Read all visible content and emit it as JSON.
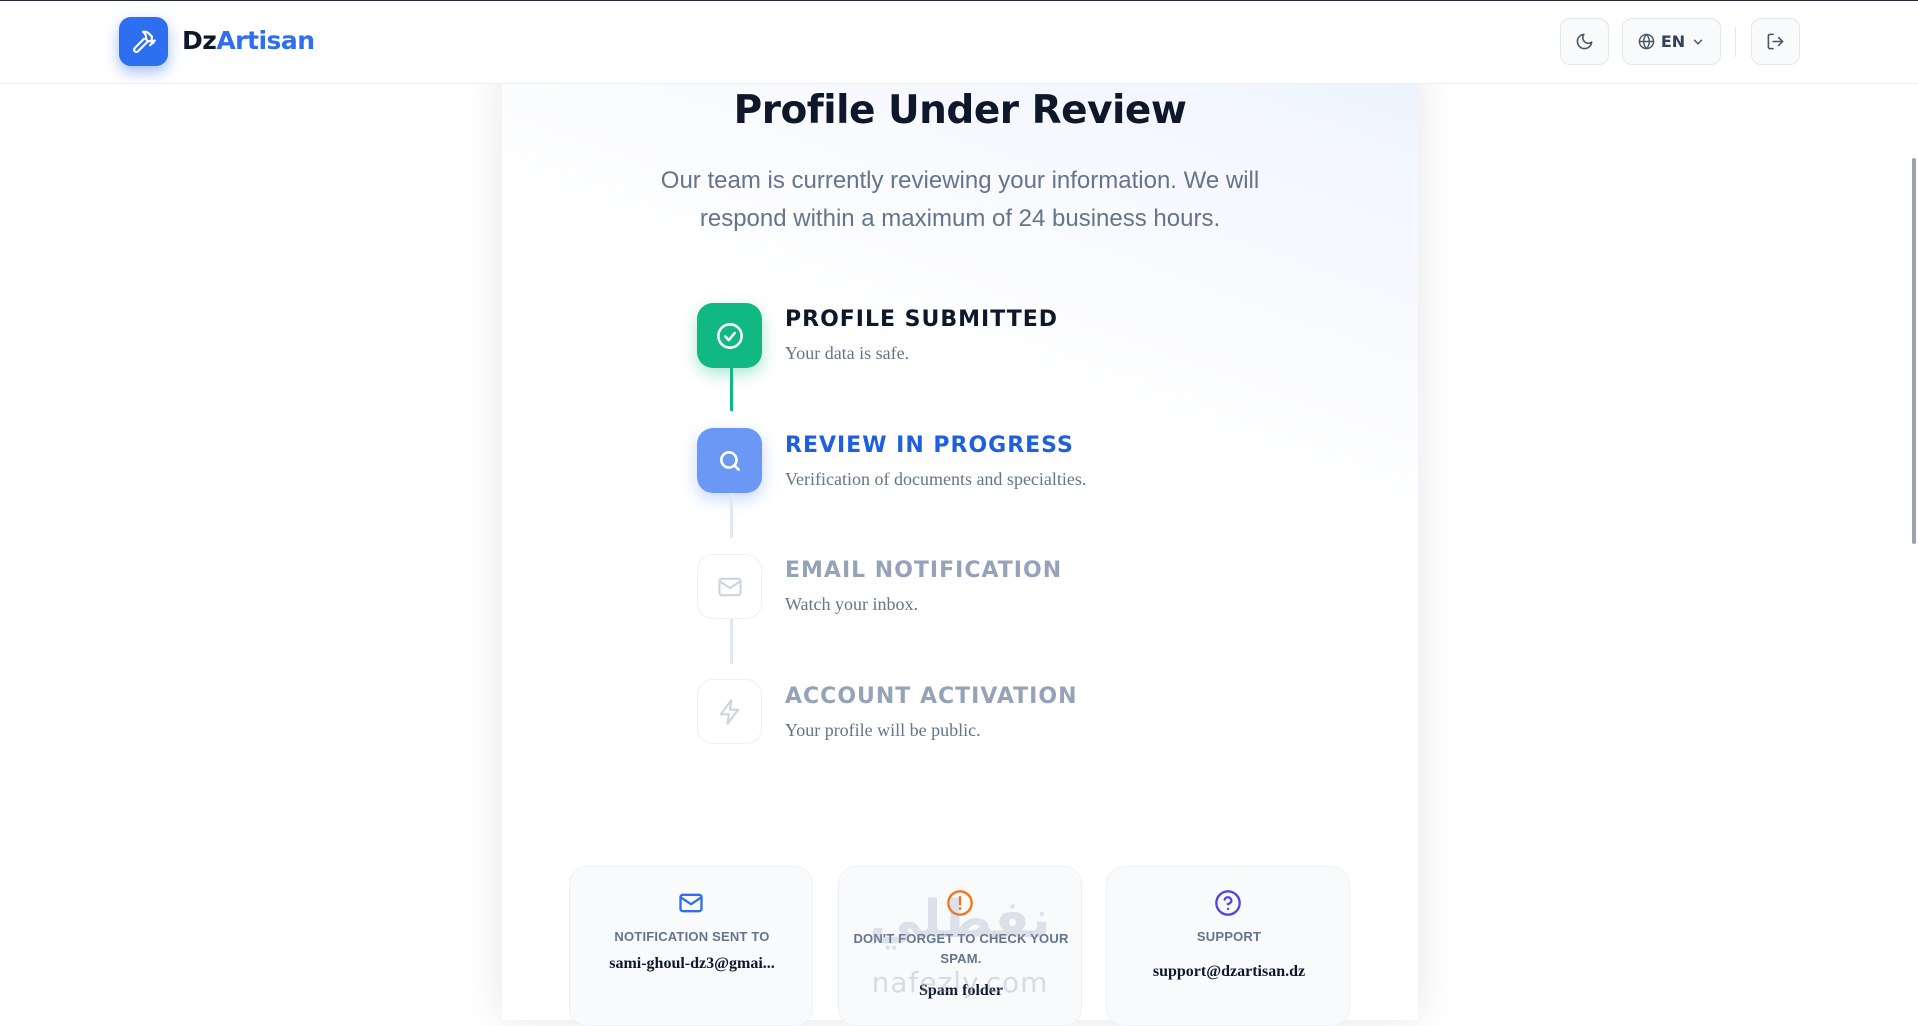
{
  "brand": {
    "name_part1": "Dz",
    "name_part2": "Artisan",
    "accent": "#2d6ff0"
  },
  "header": {
    "language": "EN",
    "icons": {
      "logo": "hammer-icon",
      "theme": "moon-icon",
      "language": "globe-icon",
      "language_caret": "chevron-down-icon",
      "logout": "logout-icon"
    }
  },
  "main": {
    "title": "Profile Under Review",
    "subtitle": "Our team is currently reviewing your information. We will respond within a maximum of 24 business hours."
  },
  "steps": [
    {
      "title": "PROFILE SUBMITTED",
      "description": "Your data is safe.",
      "state": "done",
      "icon": "check-circle-icon",
      "color": "#10b981"
    },
    {
      "title": "REVIEW IN PROGRESS",
      "description": "Verification of documents and specialties.",
      "state": "active",
      "icon": "search-icon",
      "color": "#1d5fe0"
    },
    {
      "title": "EMAIL NOTIFICATION",
      "description": "Watch your inbox.",
      "state": "pending",
      "icon": "mail-icon",
      "color": "#94a3b8"
    },
    {
      "title": "ACCOUNT ACTIVATION",
      "description": "Your profile will be public.",
      "state": "pending",
      "icon": "lightning-icon",
      "color": "#94a3b8"
    }
  ],
  "info_cards": [
    {
      "label": "NOTIFICATION SENT TO",
      "value": "sami-ghoul-dz3@gmai...",
      "icon": "mail-icon",
      "icon_color": "#2d6ff0"
    },
    {
      "label": "DON'T FORGET TO CHECK YOUR SPAM.",
      "value": "Spam folder",
      "icon": "alert-circle-icon",
      "icon_color": "#f97316"
    },
    {
      "label": "SUPPORT",
      "value": "support@dzartisan.dz",
      "icon": "help-circle-icon",
      "icon_color": "#4f46e5"
    }
  ],
  "watermark": {
    "arabic": "نفطلي",
    "latin": "nafezly.com"
  }
}
